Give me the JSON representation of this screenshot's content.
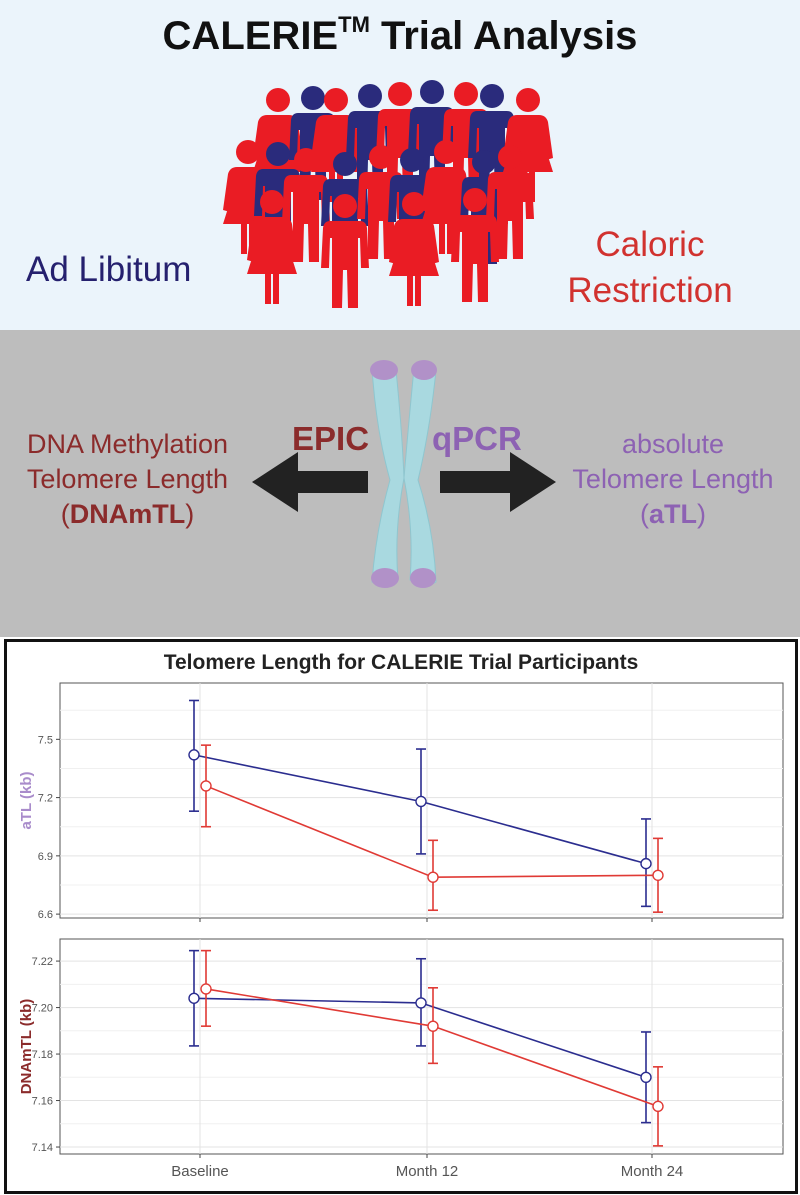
{
  "header": {
    "title_main": "CALERIE",
    "title_sup": "TM",
    "title_rest": " Trial Analysis",
    "ad_libitum_label": "Ad Libitum",
    "caloric_label_line1": "Caloric",
    "caloric_label_line2": "Restriction"
  },
  "methods": {
    "dnam_line1": "DNA Methylation",
    "dnam_line2": "Telomere Length",
    "dnam_paren_open": "(",
    "dnam_abbrev": "DNAmTL",
    "dnam_paren_close": ")",
    "epic_label": "EPIC",
    "qpcr_label": "qPCR",
    "atl_line1": "absolute",
    "atl_line2": "Telomere Length",
    "atl_paren_open": "(",
    "atl_abbrev": "aTL",
    "atl_paren_close": ")"
  },
  "colors": {
    "ad_libitum": "#25206e",
    "caloric_restriction": "#d1322f",
    "series_blue": "#2b2d8f",
    "series_red": "#e03a35",
    "dnam_text": "#8b2b2b",
    "atl_text": "#8d62b3"
  },
  "chart_data": [
    {
      "type": "line",
      "title": "Telomere Length for CALERIE Trial Participants",
      "ylabel": "aTL (kb)",
      "categories": [
        "Baseline",
        "Month 12",
        "Month 24"
      ],
      "ylim": [
        6.58,
        7.79
      ],
      "yticks": [
        6.6,
        6.9,
        7.2,
        7.5
      ],
      "grid": true,
      "series": [
        {
          "color": "#2b2d8f",
          "values": [
            7.42,
            7.18,
            6.86
          ],
          "err_low": [
            7.13,
            6.91,
            6.64
          ],
          "err_high": [
            7.7,
            7.45,
            7.09
          ]
        },
        {
          "color": "#e03a35",
          "values": [
            7.26,
            6.79,
            6.8
          ],
          "err_low": [
            7.05,
            6.62,
            6.61
          ],
          "err_high": [
            7.47,
            6.98,
            6.99
          ]
        }
      ]
    },
    {
      "type": "line",
      "ylabel": "DNAmTL (kb)",
      "categories": [
        "Baseline",
        "Month 12",
        "Month 24"
      ],
      "ylim": [
        7.137,
        7.2295
      ],
      "yticks": [
        7.14,
        7.16,
        7.18,
        7.2,
        7.22
      ],
      "grid": true,
      "series": [
        {
          "color": "#2b2d8f",
          "values": [
            7.204,
            7.202,
            7.17
          ],
          "err_low": [
            7.1835,
            7.1835,
            7.1505
          ],
          "err_high": [
            7.2245,
            7.221,
            7.1895
          ]
        },
        {
          "color": "#e03a35",
          "values": [
            7.208,
            7.192,
            7.1575
          ],
          "err_low": [
            7.192,
            7.176,
            7.1405
          ],
          "err_high": [
            7.2245,
            7.2085,
            7.1745
          ]
        }
      ]
    }
  ]
}
